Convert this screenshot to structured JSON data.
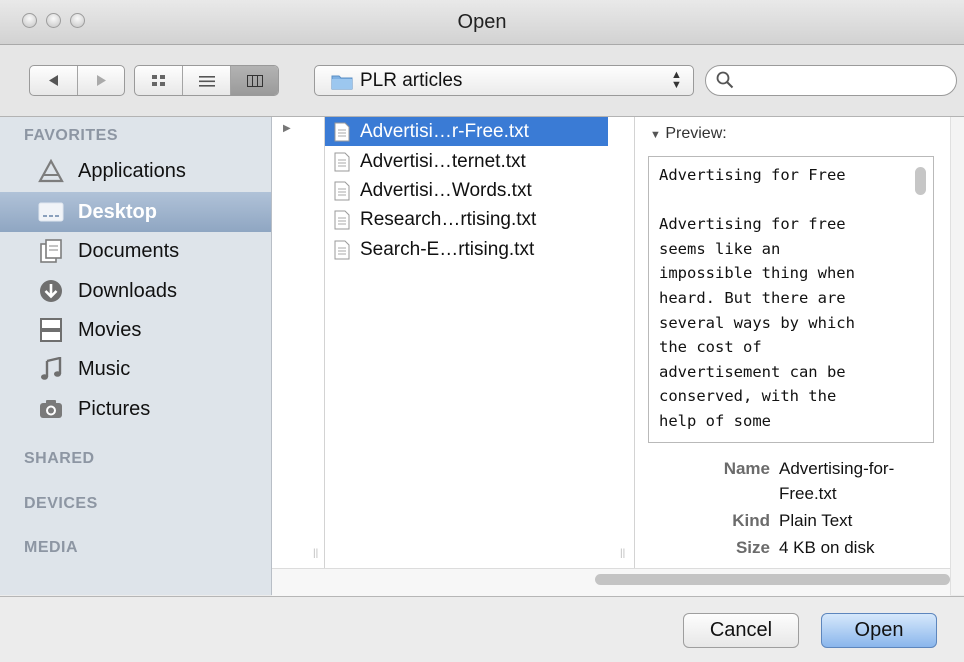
{
  "window": {
    "title": "Open"
  },
  "toolbar": {
    "location_label": "PLR articles",
    "search_placeholder": ""
  },
  "sidebar": {
    "favorites_header": "FAVORITES",
    "items": [
      {
        "label": "Applications",
        "icon": "applications-icon"
      },
      {
        "label": "Desktop",
        "icon": "desktop-icon",
        "selected": true
      },
      {
        "label": "Documents",
        "icon": "documents-icon"
      },
      {
        "label": "Downloads",
        "icon": "downloads-icon"
      },
      {
        "label": "Movies",
        "icon": "movies-icon"
      },
      {
        "label": "Music",
        "icon": "music-icon"
      },
      {
        "label": "Pictures",
        "icon": "pictures-icon"
      }
    ],
    "shared_header": "SHARED",
    "devices_header": "DEVICES",
    "media_header": "MEDIA"
  },
  "files": [
    {
      "name": "Advertisi…r-Free.txt",
      "selected": true
    },
    {
      "name": "Advertisi…ternet.txt"
    },
    {
      "name": "Advertisi…Words.txt"
    },
    {
      "name": "Research…rtising.txt"
    },
    {
      "name": "Search-E…rtising.txt"
    }
  ],
  "preview": {
    "header": "Preview:",
    "text": "Advertising for Free\n\nAdvertising for free\nseems like an\nimpossible thing when\nheard. But there are\nseveral ways by which\nthe cost of\nadvertisement can be\nconserved, with the\nhelp of some",
    "name_key": "Name",
    "name_value_1": "Advertising-for-",
    "name_value_2": "Free.txt",
    "kind_key": "Kind",
    "kind_value": "Plain Text",
    "size_key": "Size",
    "size_value": "4 KB on disk"
  },
  "buttons": {
    "cancel": "Cancel",
    "open": "Open"
  },
  "colors": {
    "selection": "#3a7bd5",
    "sidebar_bg": "#dee4ea",
    "sidebar_selection": "#9fb3cd"
  }
}
